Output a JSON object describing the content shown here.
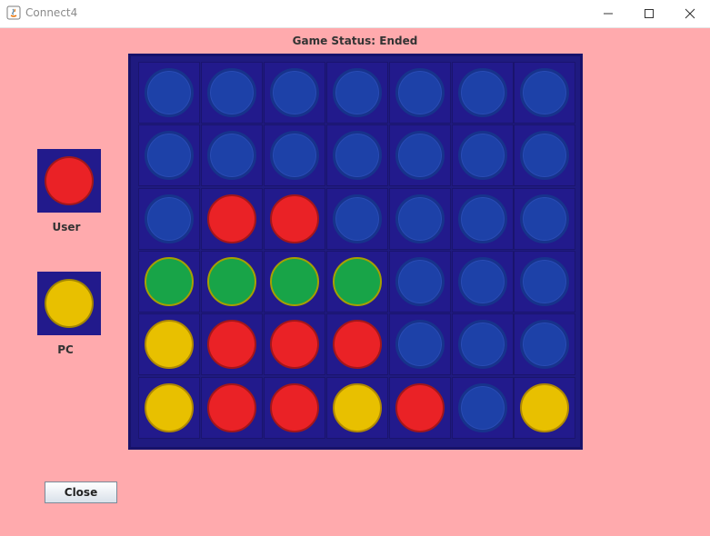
{
  "window": {
    "title": "Connect4",
    "controls": [
      "minimize-icon",
      "maximize-icon",
      "close-icon"
    ]
  },
  "status": {
    "text": "Game Status: Ended"
  },
  "legend": {
    "user_label": "User",
    "user_color": "#ea2226",
    "pc_label": "PC",
    "pc_color": "#e8c000"
  },
  "board": {
    "columns": 7,
    "rows": 6,
    "cells": [
      [
        "empty",
        "empty",
        "empty",
        "empty",
        "empty",
        "empty",
        "empty"
      ],
      [
        "empty",
        "empty",
        "empty",
        "empty",
        "empty",
        "empty",
        "empty"
      ],
      [
        "empty",
        "red",
        "red",
        "empty",
        "empty",
        "empty",
        "empty"
      ],
      [
        "green",
        "green",
        "green",
        "green",
        "empty",
        "empty",
        "empty"
      ],
      [
        "yellow",
        "red",
        "red",
        "red",
        "empty",
        "empty",
        "empty"
      ],
      [
        "yellow",
        "red",
        "red",
        "yellow",
        "red",
        "empty",
        "yellow"
      ]
    ],
    "colors": {
      "board": "#221a8c",
      "empty": "#1d41a8",
      "red": "#ea2226",
      "yellow": "#e8c000",
      "green": "#18a448"
    }
  },
  "buttons": {
    "close_label": "Close"
  },
  "colors": {
    "background": "#ffaaad"
  }
}
